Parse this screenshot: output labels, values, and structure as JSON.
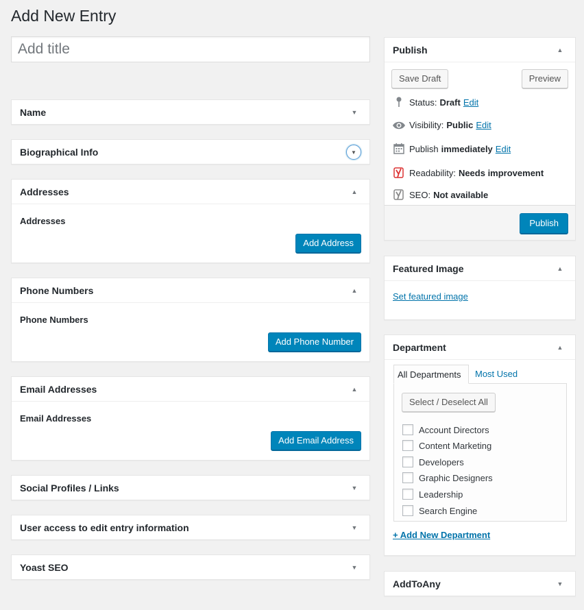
{
  "page": {
    "title": "Add New Entry"
  },
  "title_field": {
    "placeholder": "Add title",
    "value": ""
  },
  "left_boxes": {
    "name": {
      "title": "Name"
    },
    "bio": {
      "title": "Biographical Info"
    },
    "addresses": {
      "title": "Addresses",
      "label": "Addresses",
      "button": "Add Address"
    },
    "phones": {
      "title": "Phone Numbers",
      "label": "Phone Numbers",
      "button": "Add Phone Number"
    },
    "emails": {
      "title": "Email Addresses",
      "label": "Email Addresses",
      "button": "Add Email Address"
    },
    "social": {
      "title": "Social Profiles / Links"
    },
    "access": {
      "title": "User access to edit entry information"
    },
    "yoast": {
      "title": "Yoast SEO"
    }
  },
  "publish": {
    "title": "Publish",
    "save_draft": "Save Draft",
    "preview": "Preview",
    "status_label": "Status:",
    "status_value": "Draft",
    "visibility_label": "Visibility:",
    "visibility_value": "Public",
    "schedule_label": "Publish",
    "schedule_value": "immediately",
    "readability_label": "Readability:",
    "readability_value": "Needs improvement",
    "seo_label": "SEO:",
    "seo_value": "Not available",
    "edit": "Edit",
    "publish_button": "Publish",
    "colors": {
      "readability": "#dc3232",
      "seo": "#888888"
    }
  },
  "featured_image": {
    "title": "Featured Image",
    "link": "Set featured image"
  },
  "department": {
    "title": "Department",
    "tabs": [
      "All Departments",
      "Most Used"
    ],
    "select_all": "Select / Deselect All",
    "items": [
      "Account Directors",
      "Content Marketing",
      "Developers",
      "Graphic Designers",
      "Leadership",
      "Search Engine"
    ],
    "add_new": "+ Add New Department"
  },
  "addtoany": {
    "title": "AddToAny"
  },
  "icons": {
    "collapse_up": "▲",
    "expand_down": "▼"
  },
  "colors": {
    "accent": "#0085ba",
    "link": "#0073aa"
  }
}
